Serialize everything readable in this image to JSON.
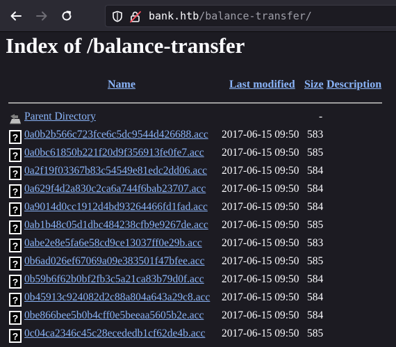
{
  "browser": {
    "url_host": "bank.htb",
    "url_path": "/balance-transfer/"
  },
  "page": {
    "title": "Index of /balance-transfer",
    "headers": {
      "name": "Name",
      "last_modified": "Last modified",
      "size": "Size",
      "description": "Description"
    },
    "parent": {
      "label": "Parent Directory",
      "size": "-"
    },
    "files": [
      {
        "name": "0a0b2b566c723fce6c5dc9544d426688.acc",
        "modified": "2017-06-15 09:50",
        "size": "583"
      },
      {
        "name": "0a0bc61850b221f20d9f356913fe0fe7.acc",
        "modified": "2017-06-15 09:50",
        "size": "585"
      },
      {
        "name": "0a2f19f03367b83c54549e81edc2dd06.acc",
        "modified": "2017-06-15 09:50",
        "size": "584"
      },
      {
        "name": "0a629f4d2a830c2ca6a744f6bab23707.acc",
        "modified": "2017-06-15 09:50",
        "size": "584"
      },
      {
        "name": "0a9014d0cc1912d4bd93264466fd1fad.acc",
        "modified": "2017-06-15 09:50",
        "size": "584"
      },
      {
        "name": "0ab1b48c05d1dbc484238cfb9e9267de.acc",
        "modified": "2017-06-15 09:50",
        "size": "585"
      },
      {
        "name": "0abe2e8e5fa6e58cd9ce13037ff0e29b.acc",
        "modified": "2017-06-15 09:50",
        "size": "583"
      },
      {
        "name": "0b6ad026ef67069a09e383501f47bfee.acc",
        "modified": "2017-06-15 09:50",
        "size": "585"
      },
      {
        "name": "0b59b6f62b0bf2fb3c5a21ca83b79d0f.acc",
        "modified": "2017-06-15 09:50",
        "size": "584"
      },
      {
        "name": "0b45913c924082d2c88a804a643a29c8.acc",
        "modified": "2017-06-15 09:50",
        "size": "584"
      },
      {
        "name": "0be866bee5b0b4cff0e5beeaa5605b2e.acc",
        "modified": "2017-06-15 09:50",
        "size": "584"
      },
      {
        "name": "0c04ca2346c45c28ecededb1cf62de4b.acc",
        "modified": "2017-06-15 09:50",
        "size": "585"
      }
    ]
  }
}
